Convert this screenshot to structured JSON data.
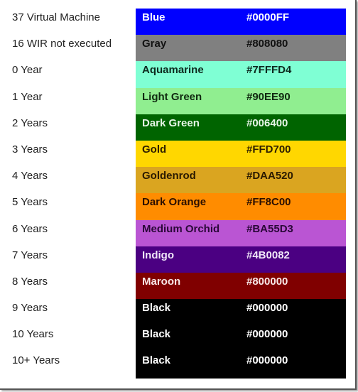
{
  "rows": [
    {
      "label": "37 Virtual Machine",
      "name": "Blue",
      "hex": "#0000FF",
      "bg": "#0000FF",
      "fg": "#ffffff"
    },
    {
      "label": "16 WIR not executed",
      "name": "Gray",
      "hex": "#808080",
      "bg": "#808080",
      "fg": "#111111"
    },
    {
      "label": "0 Year",
      "name": "Aquamarine",
      "hex": "#7FFFD4",
      "bg": "#7FFFD4",
      "fg": "#0d2a1e"
    },
    {
      "label": "1 Year",
      "name": "Light Green",
      "hex": "#90EE90",
      "bg": "#90EE90",
      "fg": "#102a10"
    },
    {
      "label": "2 Years",
      "name": "Dark Green",
      "hex": "#006400",
      "bg": "#006400",
      "fg": "#e6f5e6"
    },
    {
      "label": "3 Years",
      "name": "Gold",
      "hex": "#FFD700",
      "bg": "#FFD700",
      "fg": "#2e1e00"
    },
    {
      "label": "4 Years",
      "name": "Goldenrod",
      "hex": "#DAA520",
      "bg": "#DAA520",
      "fg": "#2a1a00"
    },
    {
      "label": "5 Years",
      "name": "Dark Orange",
      "hex": "#FF8C00",
      "bg": "#FF8C00",
      "fg": "#2a0e00"
    },
    {
      "label": "6 Years",
      "name": "Medium Orchid",
      "hex": "#BA55D3",
      "bg": "#BA55D3",
      "fg": "#2a0838"
    },
    {
      "label": "7 Years",
      "name": "Indigo",
      "hex": "#4B0082",
      "bg": "#4B0082",
      "fg": "#f0e6f8"
    },
    {
      "label": "8 Years",
      "name": "Maroon",
      "hex": "#800000",
      "bg": "#800000",
      "fg": "#f8e8e8"
    },
    {
      "label": "9 Years",
      "name": "Black",
      "hex": "#000000",
      "bg": "#000000",
      "fg": "#ffffff"
    },
    {
      "label": "10 Years",
      "name": "Black",
      "hex": "#000000",
      "bg": "#000000",
      "fg": "#ffffff"
    },
    {
      "label": "10+ Years",
      "name": "Black",
      "hex": "#000000",
      "bg": "#000000",
      "fg": "#ffffff"
    }
  ]
}
